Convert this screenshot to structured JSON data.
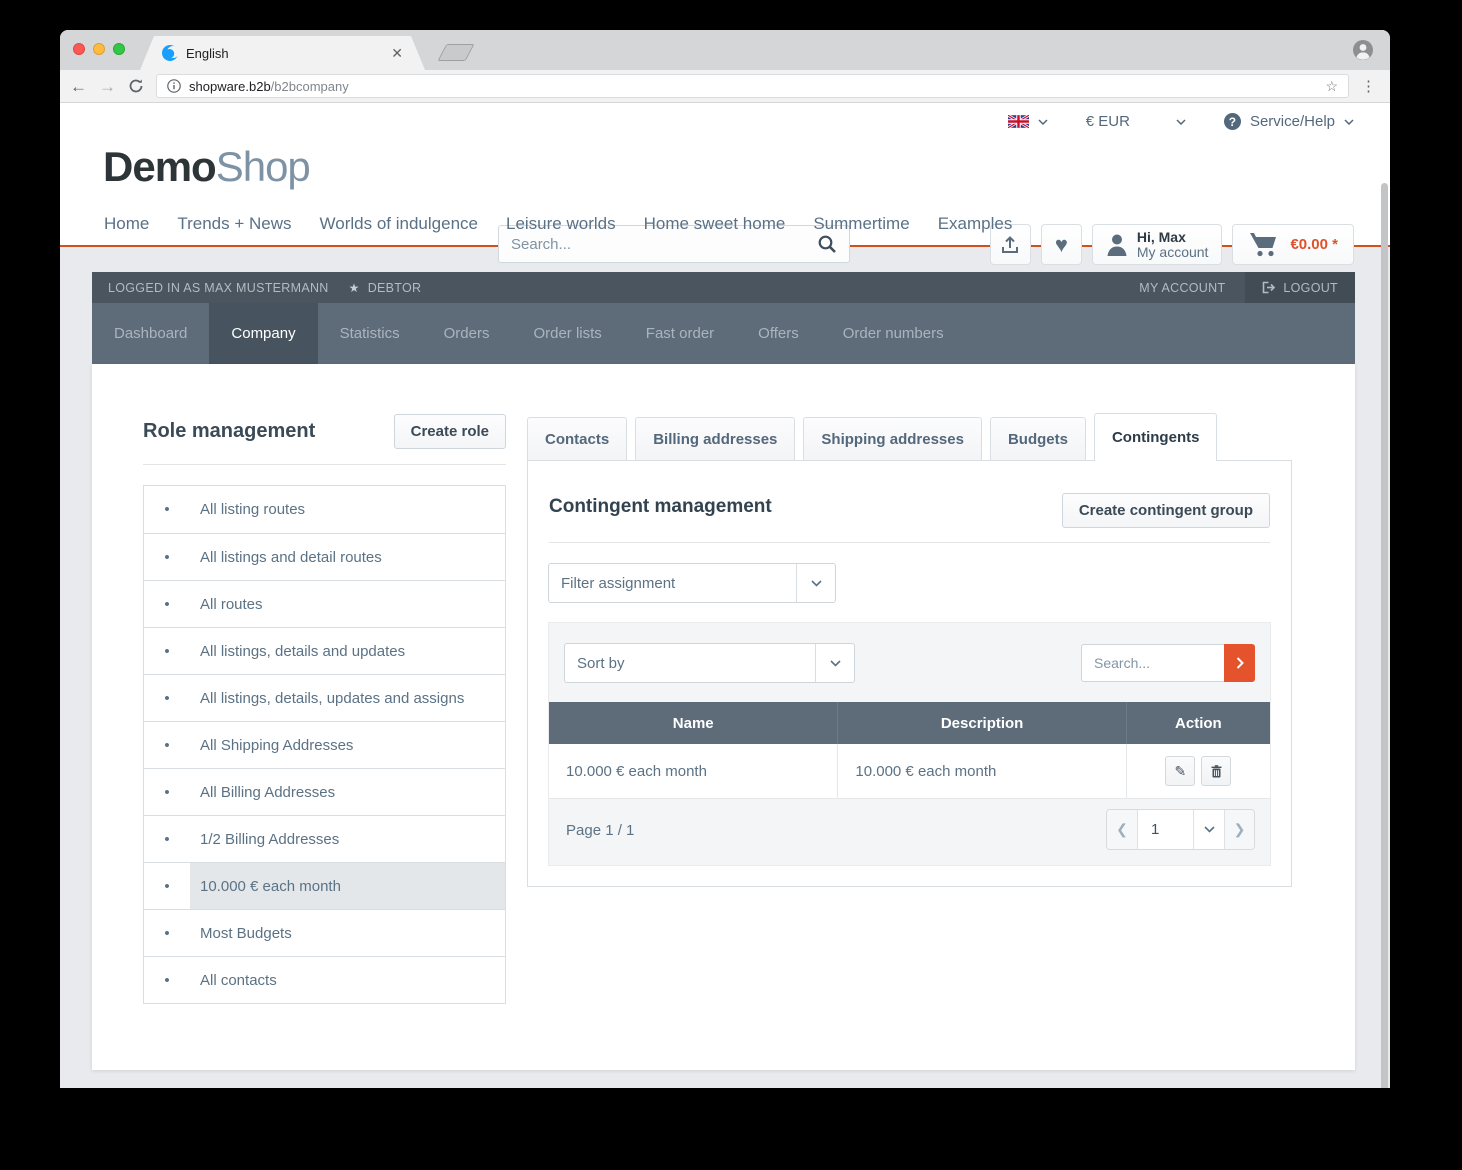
{
  "browser": {
    "tab_title": "English",
    "url_host": "shopware.b2b",
    "url_path": "/b2bcompany"
  },
  "header": {
    "currency": "€ EUR",
    "service_help": "Service/Help",
    "logo_bold": "Demo",
    "logo_light": "Shop",
    "search_placeholder": "Search...",
    "greeting": "Hi, Max",
    "account_label": "My account",
    "cart_amount": "€0.00 *",
    "nav": [
      "Home",
      "Trends + News",
      "Worlds of indulgence",
      "Leisure worlds",
      "Home sweet home",
      "Summertime",
      "Examples"
    ]
  },
  "b2b_bar": {
    "logged_in_text": "LOGGED IN AS MAX MUSTERMANN",
    "role_badge": "DEBTOR",
    "my_account": "MY ACCOUNT",
    "logout": "LOGOUT"
  },
  "b2b_nav": [
    "Dashboard",
    "Company",
    "Statistics",
    "Orders",
    "Order lists",
    "Fast order",
    "Offers",
    "Order numbers"
  ],
  "roles": {
    "title": "Role management",
    "create_button": "Create role",
    "items": [
      "All listing routes",
      "All listings and detail routes",
      "All routes",
      "All listings, details and updates",
      "All listings, details, updates and assigns",
      "All Shipping Addresses",
      "All Billing Addresses",
      "1/2 Billing Addresses",
      "10.000 € each month",
      "Most Budgets",
      "All contacts"
    ]
  },
  "tabs": [
    "Contacts",
    "Billing addresses",
    "Shipping addresses",
    "Budgets",
    "Contingents"
  ],
  "contingents": {
    "title": "Contingent management",
    "create_button": "Create contingent group",
    "filter_placeholder": "Filter assignment",
    "sort_placeholder": "Sort by",
    "search_placeholder": "Search...",
    "table": {
      "headers": [
        "Name",
        "Description",
        "Action"
      ],
      "rows": [
        {
          "name": "10.000 € each month",
          "description": "10.000 € each month"
        }
      ]
    },
    "pagination": {
      "label": "Page 1 / 1",
      "current_page": "1"
    }
  },
  "colors": {
    "accent_orange": "#e5532c",
    "slate": "#5e6c7a",
    "dark_slate": "#4b555f",
    "cart_price": "#e0512b"
  }
}
